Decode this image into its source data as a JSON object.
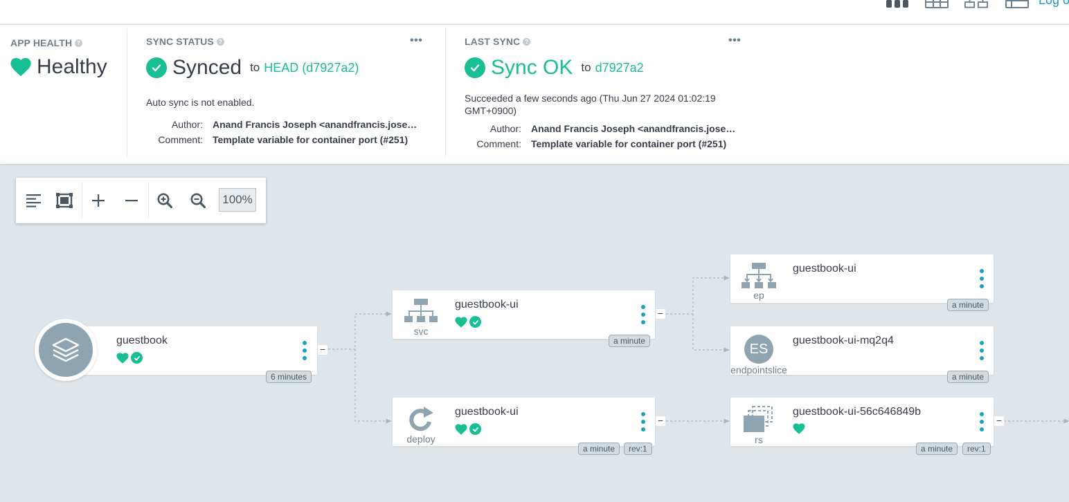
{
  "topbar": {
    "log_label": "Log o",
    "view_icons": [
      "tree-view-icon",
      "pods-view-icon",
      "network-view-icon",
      "list-view-icon"
    ]
  },
  "app_health": {
    "label": "APP HEALTH",
    "status": "Healthy"
  },
  "sync_status": {
    "label": "SYNC STATUS",
    "status": "Synced",
    "to_text": "to",
    "revision": "HEAD (d7927a2)",
    "auto_sync_text": "Auto sync is not enabled.",
    "author_label": "Author:",
    "author_value": "Anand Francis Joseph <anandfrancis.joseph@gmail.com>",
    "comment_label": "Comment:",
    "comment_value": "Template variable for container port (#251)"
  },
  "last_sync": {
    "label": "LAST SYNC",
    "status": "Sync OK",
    "to_text": "to",
    "revision": "d7927a2",
    "succeeded_text": "Succeeded a few seconds ago (Thu Jun 27 2024 01:02:19 GMT+0900)",
    "author_label": "Author:",
    "author_value": "Anand Francis Joseph <anandfrancis.joseph@gmail.com>",
    "comment_label": "Comment:",
    "comment_value": "Template variable for container port (#251)"
  },
  "toolbar": {
    "zoom_level": "100%"
  },
  "colors": {
    "healthy": "#18be94",
    "node_icon": "#8fa4b1",
    "menu_dots": "#17a3b8",
    "graph_bg": "#dee6eb"
  },
  "nodes": {
    "app": {
      "name": "guestbook",
      "age": "6 minutes",
      "health": "healthy",
      "sync": "synced"
    },
    "svc": {
      "name": "guestbook-ui",
      "kind": "svc",
      "age": "a minute",
      "health": "healthy",
      "sync": "synced"
    },
    "deploy": {
      "name": "guestbook-ui",
      "kind": "deploy",
      "age": "a minute",
      "rev": "rev:1",
      "health": "healthy",
      "sync": "synced"
    },
    "ep": {
      "name": "guestbook-ui",
      "kind": "ep",
      "age": "a minute"
    },
    "endpointslice": {
      "name": "guestbook-ui-mq2q4",
      "kind": "endpointslice",
      "icon_text": "ES",
      "age": "a minute"
    },
    "rs": {
      "name": "guestbook-ui-56c646849b",
      "kind": "rs",
      "age": "a minute",
      "rev": "rev:1",
      "health": "healthy"
    }
  }
}
